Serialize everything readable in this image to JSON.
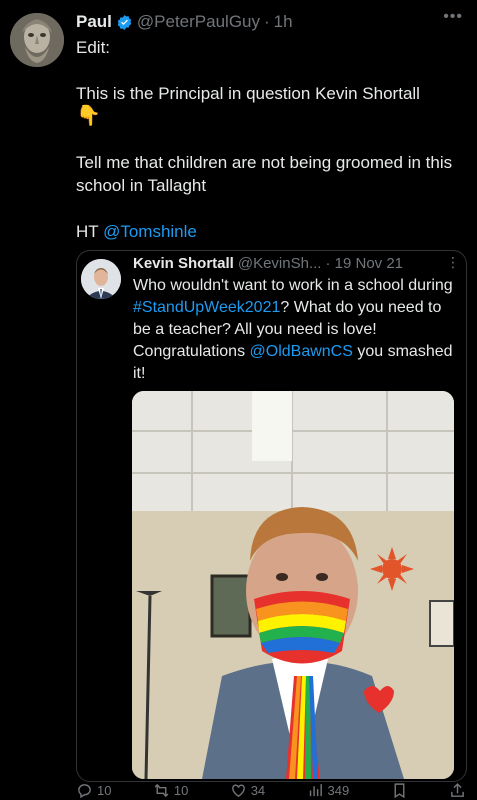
{
  "author": {
    "name": "Paul",
    "handle": "@PeterPaulGuy",
    "separator": "·",
    "time": "1h"
  },
  "tweet": {
    "line_edit": "Edit:",
    "line1": "This is the Principal in question Kevin Shortall",
    "emoji": "👇",
    "line2": "Tell me that children are not being groomed in this school in Tallaght",
    "ht_prefix": "HT ",
    "ht_mention": "@Tomshinle"
  },
  "quote": {
    "name": "Kevin Shortall",
    "handle": "@KevinSh...",
    "date": "· 19 Nov 21",
    "text_1": "Who wouldn't want to work in a school during ",
    "hashtag": "#StandUpWeek2021",
    "text_2": "? What do you need to be a teacher? All you need is love! Congratulations ",
    "mention": "@OldBawnCS",
    "text_3": " you smashed it!"
  },
  "actions": {
    "replies": "10",
    "reposts": "10",
    "likes": "34",
    "views": "349"
  },
  "colors": {
    "accent": "#1d9bf0",
    "muted": "#71767b",
    "text": "#e7e9ea",
    "background": "#000000"
  }
}
